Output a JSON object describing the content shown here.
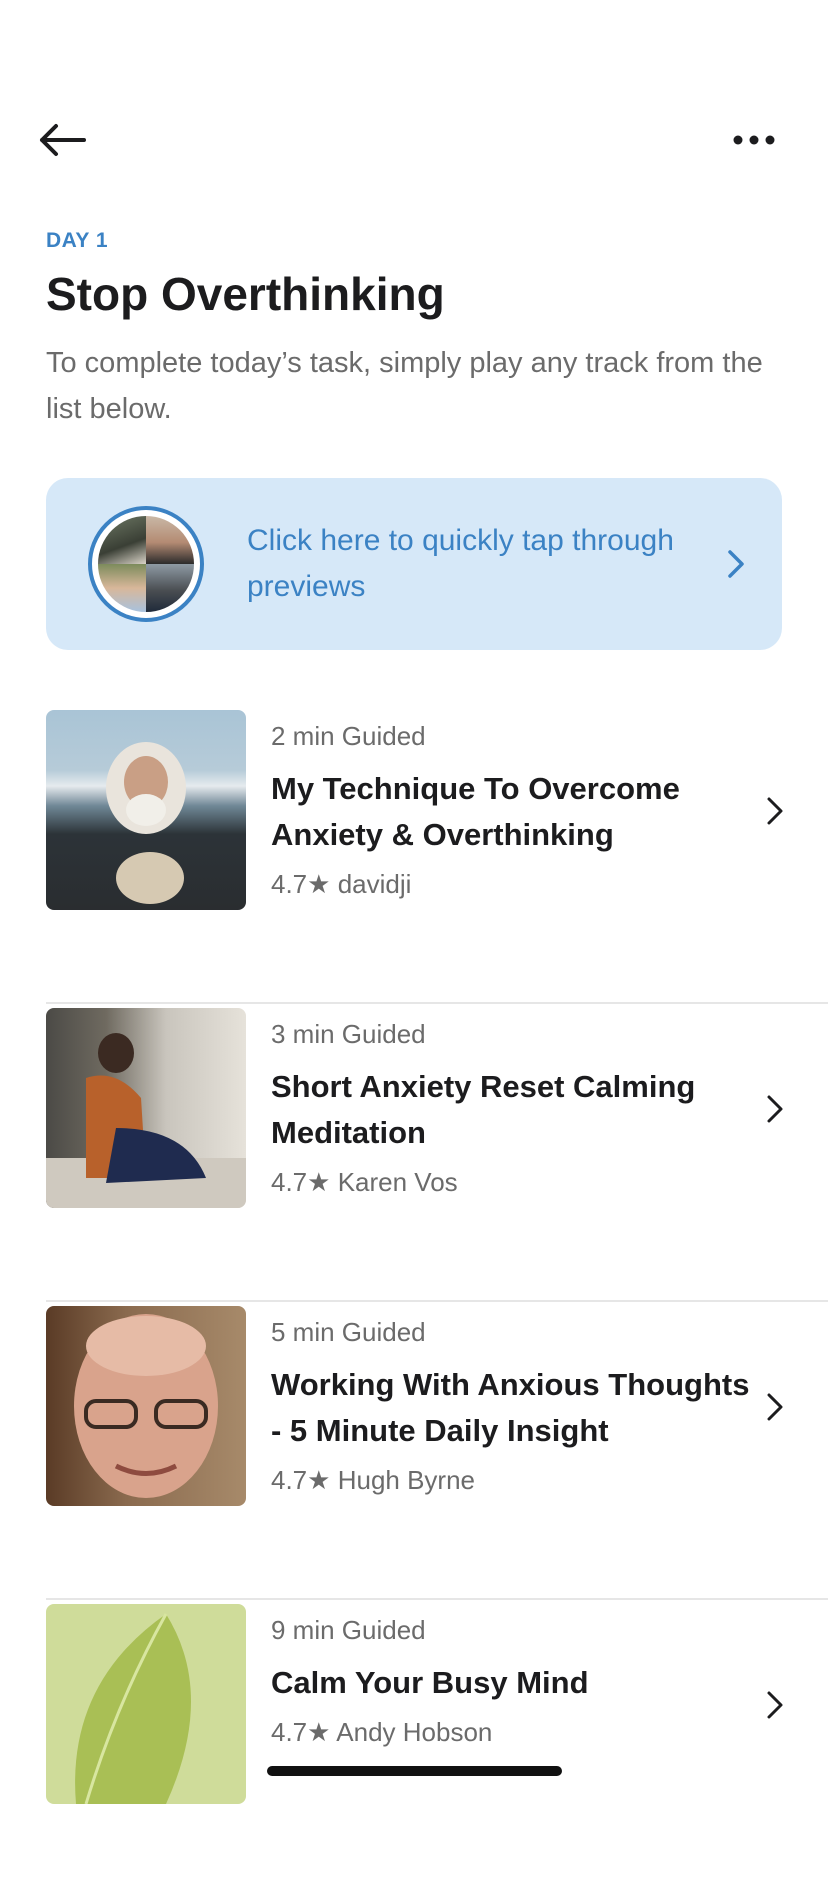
{
  "nav": {
    "back_icon": "arrow-left-icon",
    "more_icon": "more-horizontal-icon"
  },
  "header": {
    "day_label": "DAY 1",
    "title": "Stop Overthinking",
    "subtitle": "To complete today’s task, simply play any track from the list below."
  },
  "preview_banner": {
    "text": "Click here to quickly tap through previews",
    "accent_color": "#3b82c4",
    "background_color": "#d6e8f8"
  },
  "tracks": [
    {
      "duration": "2 min Guided",
      "title": "My Technique To Overcome Anxiety & Overthinking",
      "rating": "4.7",
      "author": "davidji"
    },
    {
      "duration": "3 min Guided",
      "title": "Short Anxiety Reset Calming Meditation",
      "rating": "4.7",
      "author": "Karen Vos"
    },
    {
      "duration": "5 min Guided",
      "title": "Working With Anxious Thoughts  - 5 Minute Daily Insight",
      "rating": "4.7",
      "author": "Hugh Byrne"
    },
    {
      "duration": "9 min Guided",
      "title": "Calm Your Busy Mind",
      "rating": "4.7",
      "author": "Andy Hobson"
    }
  ]
}
